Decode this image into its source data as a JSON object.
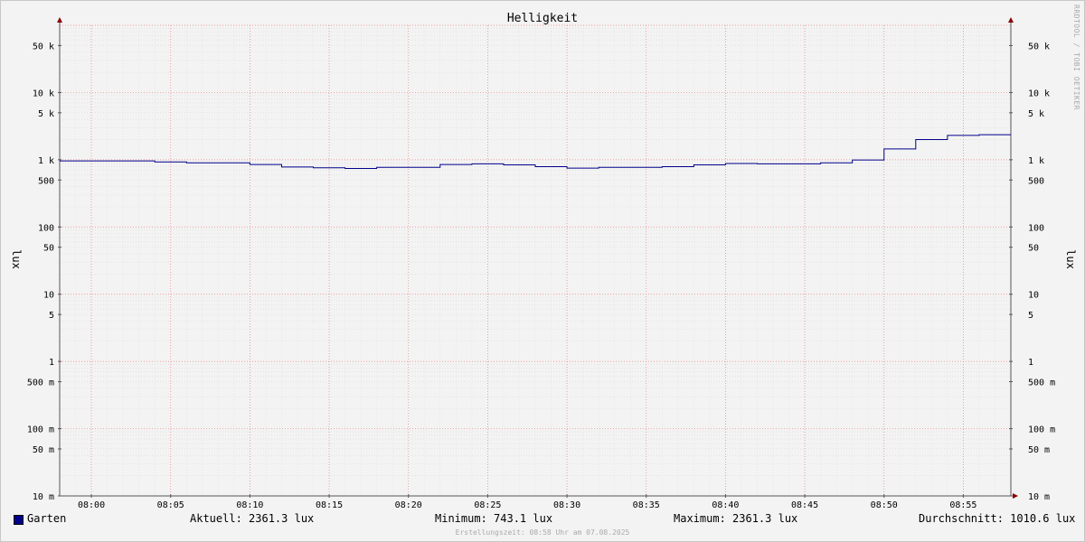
{
  "chart_data": {
    "type": "line",
    "title": "Helligkeit",
    "ylabel": "lux",
    "y_scale": "log",
    "ylim": [
      0.01,
      100000
    ],
    "y_ticks": [
      {
        "value": 50000,
        "label": "50 k"
      },
      {
        "value": 10000,
        "label": "10 k"
      },
      {
        "value": 5000,
        "label": "5 k"
      },
      {
        "value": 1000,
        "label": "1 k"
      },
      {
        "value": 500,
        "label": "500"
      },
      {
        "value": 100,
        "label": "100"
      },
      {
        "value": 50,
        "label": "50"
      },
      {
        "value": 10,
        "label": "10"
      },
      {
        "value": 5,
        "label": "5"
      },
      {
        "value": 1,
        "label": "1"
      },
      {
        "value": 0.5,
        "label": "500 m"
      },
      {
        "value": 0.1,
        "label": "100 m"
      },
      {
        "value": 0.05,
        "label": "50 m"
      },
      {
        "value": 0.01,
        "label": "10 m"
      }
    ],
    "x_ticks": [
      "08:00",
      "08:05",
      "08:10",
      "08:15",
      "08:20",
      "08:25",
      "08:30",
      "08:35",
      "08:40",
      "08:45",
      "08:50",
      "08:55"
    ],
    "xlim": [
      "07:58",
      "08:58"
    ],
    "grid": true,
    "series": [
      {
        "name": "Garten",
        "color": "#00008b",
        "step": true,
        "x": [
          "07:58",
          "08:00",
          "08:02",
          "08:04",
          "08:06",
          "08:08",
          "08:10",
          "08:12",
          "08:14",
          "08:16",
          "08:18",
          "08:20",
          "08:22",
          "08:24",
          "08:26",
          "08:28",
          "08:30",
          "08:32",
          "08:34",
          "08:36",
          "08:38",
          "08:40",
          "08:42",
          "08:44",
          "08:46",
          "08:48",
          "08:50",
          "08:52",
          "08:54",
          "08:56"
        ],
        "values": [
          960,
          960,
          960,
          930,
          900,
          900,
          850,
          780,
          760,
          743.1,
          770,
          770,
          850,
          870,
          840,
          790,
          750,
          770,
          770,
          790,
          840,
          880,
          870,
          870,
          900,
          990,
          1450,
          2000,
          2300,
          2361.3
        ]
      }
    ]
  },
  "legend": {
    "series_name": "Garten",
    "current": "Aktuell: 2361.3 lux",
    "minimum": "Minimum: 743.1 lux",
    "maximum": "Maximum: 2361.3 lux",
    "average": "Durchschnitt: 1010.6 lux"
  },
  "footer": "Erstellungszeit: 08:58 Uhr am 07.08.2025",
  "watermark": "RRDTOOL / TOBI OETIKER"
}
